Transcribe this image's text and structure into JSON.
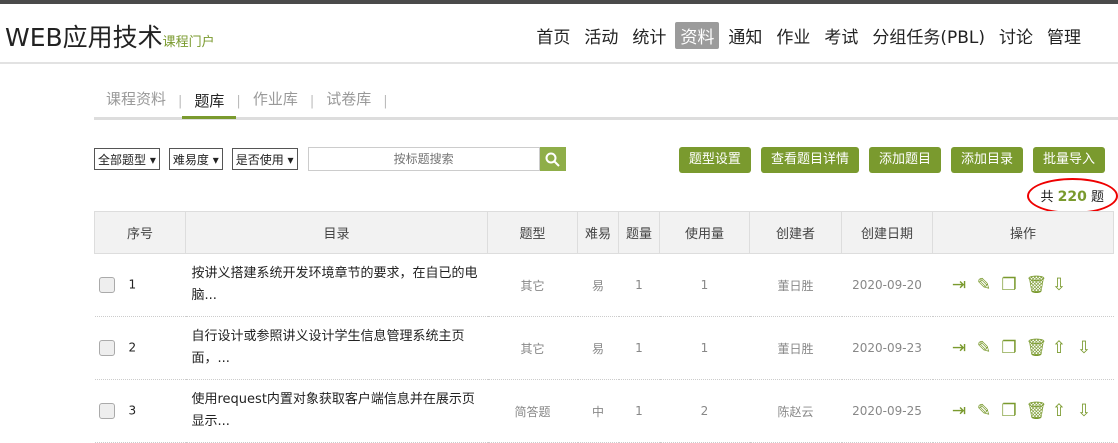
{
  "header": {
    "title": "WEB应用技术",
    "subtitle": "课程门户",
    "nav": [
      "首页",
      "活动",
      "统计",
      "资料",
      "通知",
      "作业",
      "考试",
      "分组任务(PBL)",
      "讨论",
      "管理"
    ],
    "active_nav": "资料"
  },
  "subtabs": [
    "课程资料",
    "题库",
    "作业库",
    "试卷库"
  ],
  "filters": {
    "type": "全部题型",
    "difficulty": "难易度",
    "used": "是否使用",
    "search_placeholder": "按标题搜索"
  },
  "buttons": [
    "题型设置",
    "查看题目详情",
    "添加题目",
    "添加目录",
    "批量导入"
  ],
  "count": {
    "prefix": "共",
    "value": "220",
    "suffix": "题"
  },
  "columns": [
    "序号",
    "目录",
    "题型",
    "难易",
    "题量",
    "使用量",
    "创建者",
    "创建日期",
    "操作"
  ],
  "rows": [
    {
      "no": "1",
      "title": "按讲义搭建系统开发环境章节的要求，在自已的电脑...",
      "type": "其它",
      "diff": "易",
      "qty": "1",
      "used": "1",
      "creator": "董日胜",
      "date": "2020-09-20",
      "ops": [
        "move",
        "edit",
        "copy",
        "delete",
        "down"
      ]
    },
    {
      "no": "2",
      "title": "自行设计或参照讲义设计学生信息管理系统主页面，...",
      "type": "其它",
      "diff": "易",
      "qty": "1",
      "used": "1",
      "creator": "董日胜",
      "date": "2020-09-23",
      "ops": [
        "move",
        "edit",
        "copy",
        "delete",
        "up",
        "down"
      ]
    },
    {
      "no": "3",
      "title": "使用request内置对象获取客户端信息并在展示页显示...",
      "type": "简答题",
      "diff": "中",
      "qty": "1",
      "used": "2",
      "creator": "陈赵云",
      "date": "2020-09-25",
      "ops": [
        "move",
        "edit",
        "copy",
        "delete",
        "up",
        "down"
      ]
    }
  ]
}
